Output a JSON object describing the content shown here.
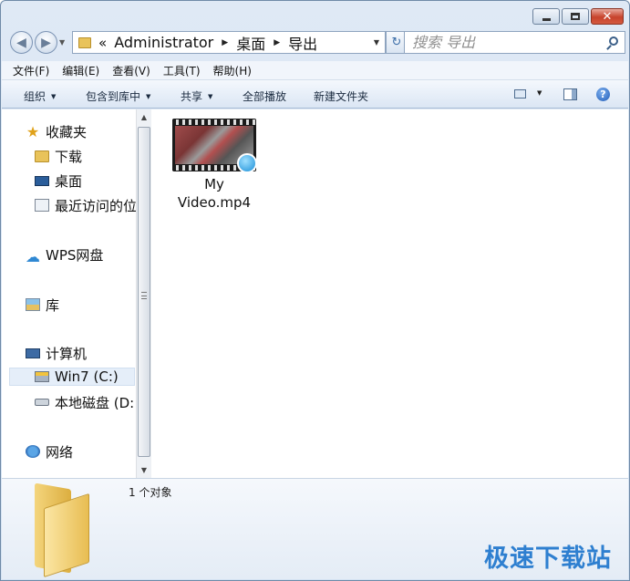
{
  "window": {
    "caption": {
      "minimize": "▁",
      "maximize": "□",
      "close": "✕"
    }
  },
  "nav": {
    "back_icon": "arrow-left-icon",
    "forward_icon": "arrow-right-icon",
    "address": {
      "overflow": "«",
      "crumbs": [
        "Administrator",
        "桌面",
        "导出"
      ]
    },
    "search_placeholder": "搜索 导出"
  },
  "menubar": {
    "items": [
      "文件(F)",
      "编辑(E)",
      "查看(V)",
      "工具(T)",
      "帮助(H)"
    ]
  },
  "toolbar": {
    "organize": "组织",
    "include_in_library": "包含到库中",
    "share": "共享",
    "play_all": "全部播放",
    "new_folder": "新建文件夹",
    "help": "?"
  },
  "sidebar": {
    "items": [
      {
        "label": "收藏夹",
        "icon": "star-icon"
      },
      {
        "label": "下载",
        "icon": "folder-icon"
      },
      {
        "label": "桌面",
        "icon": "desktop-icon"
      },
      {
        "label": "最近访问的位",
        "icon": "recent-places-icon"
      },
      {
        "label": "WPS网盘",
        "icon": "cloud-icon"
      },
      {
        "label": "库",
        "icon": "library-icon"
      },
      {
        "label": "计算机",
        "icon": "computer-icon"
      },
      {
        "label": "Win7 (C:)",
        "icon": "drive-c-icon",
        "selected": true
      },
      {
        "label": "本地磁盘 (D:",
        "icon": "drive-icon"
      },
      {
        "label": "网络",
        "icon": "network-icon"
      }
    ]
  },
  "content": {
    "files": [
      {
        "name": "My Video.mp4",
        "icon": "video-file-icon"
      }
    ]
  },
  "details": {
    "count": "1 个对象",
    "watermark": "极速下载站"
  },
  "colors": {
    "accent": "#2e7fd0",
    "selection": "#e5eef9",
    "close_red": "#c7432b"
  }
}
